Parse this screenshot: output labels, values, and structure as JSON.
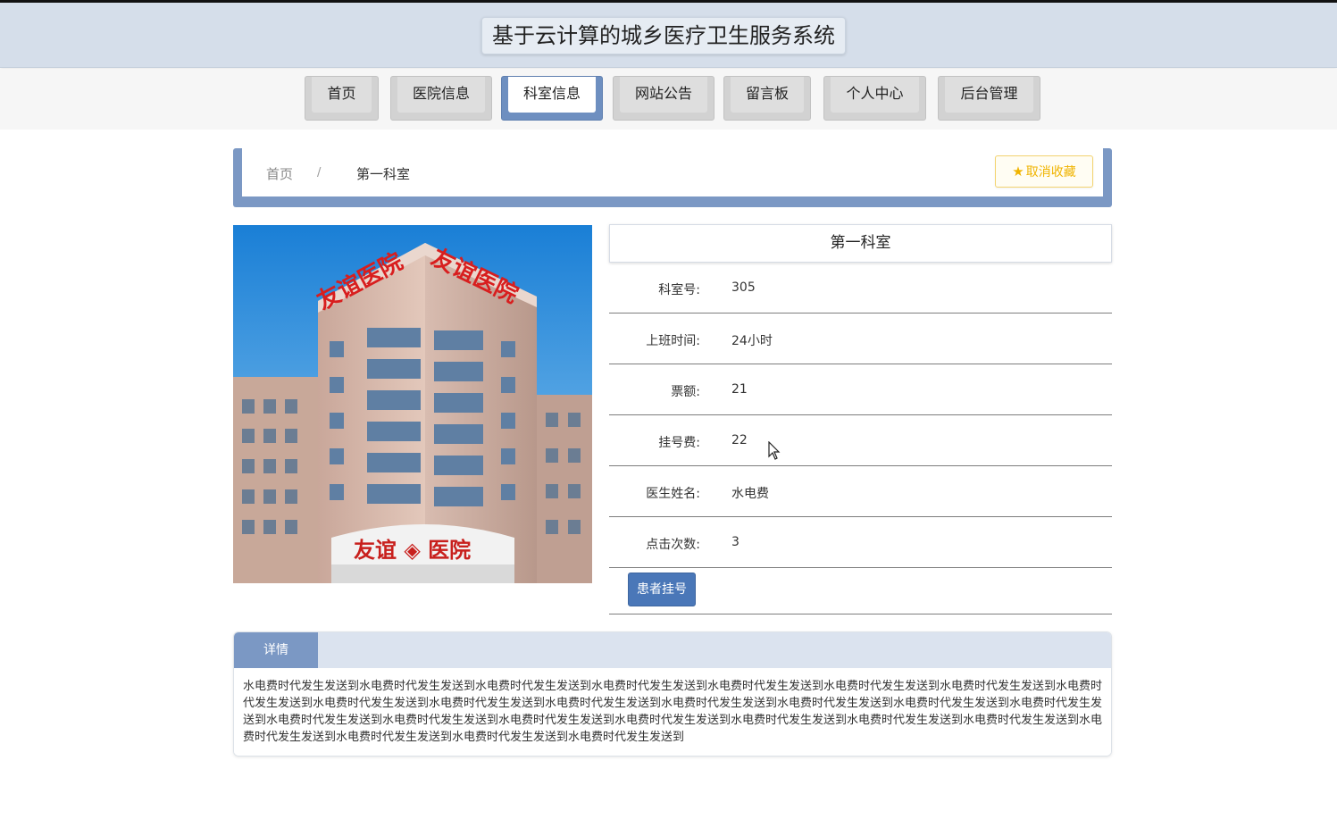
{
  "header": {
    "title": "基于云计算的城乡医疗卫生服务系统"
  },
  "nav": {
    "items": [
      {
        "label": "首页"
      },
      {
        "label": "医院信息"
      },
      {
        "label": "科室信息",
        "active": true
      },
      {
        "label": "网站公告"
      },
      {
        "label": "留言板"
      },
      {
        "label": "个人中心"
      },
      {
        "label": "后台管理"
      }
    ]
  },
  "breadcrumb": {
    "home": "首页",
    "separator": "/",
    "current": "第一科室"
  },
  "favorite_button": {
    "label": "取消收藏",
    "icon": "star-icon",
    "color": "#f0b400"
  },
  "photo": {
    "sign_roof": "友谊医院",
    "sign_entrance": "友谊医院"
  },
  "info": {
    "title": "第一科室",
    "rows": [
      {
        "label": "科室号:",
        "value": "305"
      },
      {
        "label": "上班时间:",
        "value": "24小时"
      },
      {
        "label": "票额:",
        "value": "21"
      },
      {
        "label": "挂号费:",
        "value": "22"
      },
      {
        "label": "医生姓名:",
        "value": "水电费"
      },
      {
        "label": "点击次数:",
        "value": "3"
      }
    ],
    "register_button": "患者挂号"
  },
  "detail": {
    "tab": "详情",
    "content": "水电费时代发生发送到水电费时代发生发送到水电费时代发生发送到水电费时代发生发送到水电费时代发生发送到水电费时代发生发送到水电费时代发生发送到水电费时代发生发送到水电费时代发生发送到水电费时代发生发送到水电费时代发生发送到水电费时代发生发送到水电费时代发生发送到水电费时代发生发送到水电费时代发生发送到水电费时代发生发送到水电费时代发生发送到水电费时代发生发送到水电费时代发生发送到水电费时代发生发送到水电费时代发生发送到水电费时代发生发送到水电费时代发生发送到水电费时代发生发送到水电费时代发生发送到水电费时代发生发送到"
  },
  "colors": {
    "accent": "#7b98c4",
    "button": "#4a77b8",
    "header_bg": "#d5deea"
  }
}
